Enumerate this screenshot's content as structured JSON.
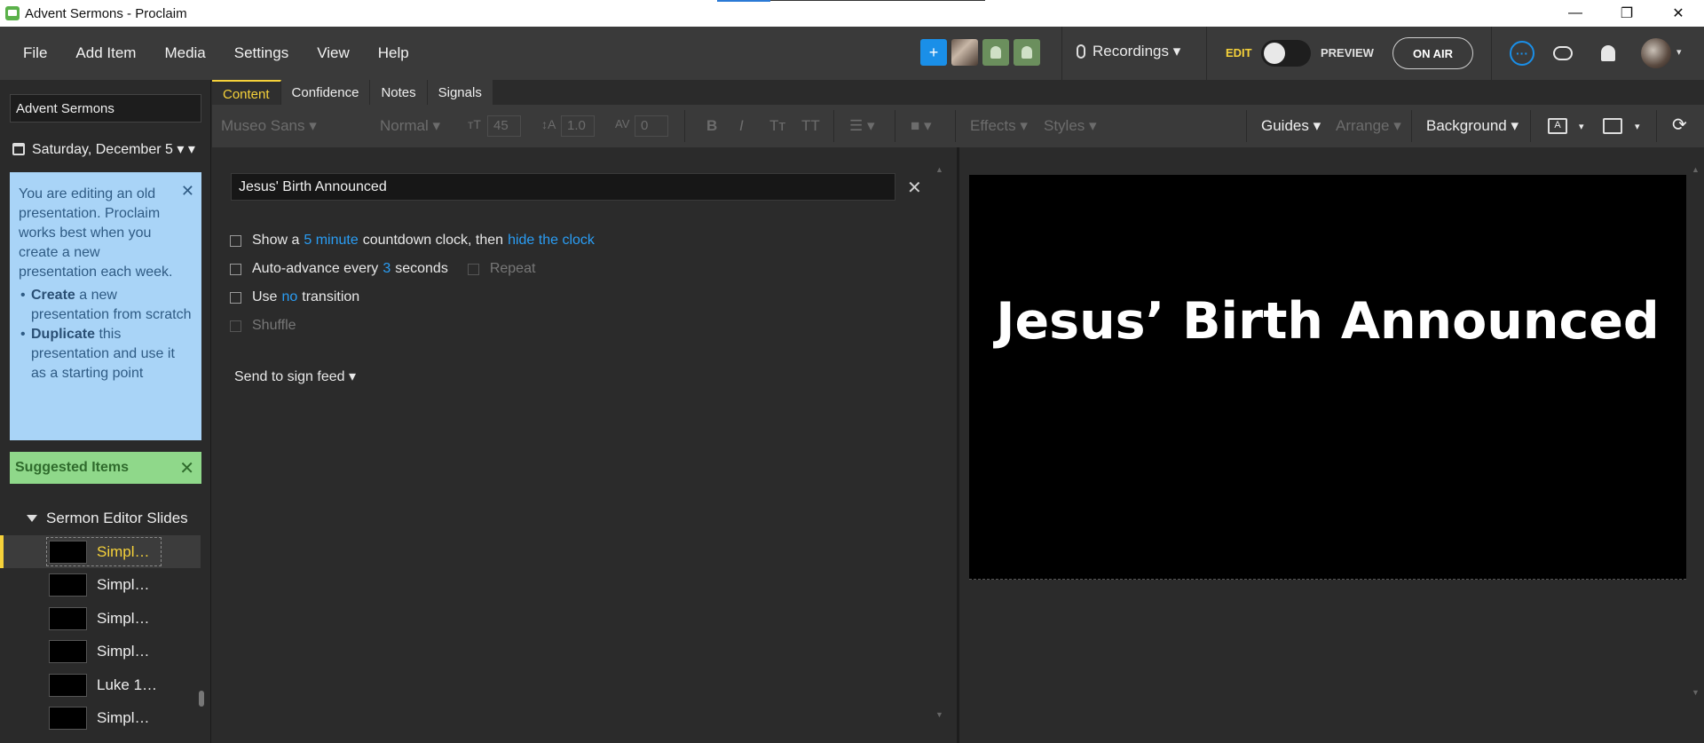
{
  "window": {
    "title": "Advent Sermons - Proclaim",
    "min": "—",
    "max": "❐",
    "close": "✕"
  },
  "menu": {
    "items": [
      "File",
      "Add Item",
      "Media",
      "Settings",
      "View",
      "Help"
    ]
  },
  "topbar": {
    "recordings": "Recordings ▾",
    "edit": "EDIT",
    "preview": "PREVIEW",
    "on_air": "ON AIR",
    "more_icon": "···",
    "add_user": "+",
    "user_caret": "▾"
  },
  "sidebar": {
    "presentation": "Advent Sermons",
    "date": "Saturday, December 5 ▾ ▾",
    "note": {
      "text": "You are editing an old presentation. Proclaim works best when you create a new presentation each week.",
      "bullet1_bold": "Create",
      "bullet1_rest": " a new presentation from scratch",
      "bullet2_bold": "Duplicate",
      "bullet2_rest": " this presentation and use it as a starting point",
      "close": "✕"
    },
    "suggested": "Suggested Items",
    "suggested_close": "✕",
    "group": "Sermon Editor Slides",
    "slides": [
      "Simpl…",
      "Simpl…",
      "Simpl…",
      "Simpl…",
      "Luke 1…",
      "Simpl…"
    ]
  },
  "tabs": [
    "Content",
    "Confidence",
    "Notes",
    "Signals"
  ],
  "toolbar": {
    "font": "Museo Sans ▾",
    "weight": "Normal ▾",
    "size": "45",
    "line_height": "1.0",
    "spacing": "0",
    "bold": "B",
    "italic": "I",
    "tt1": "Tт",
    "tt2": "TT",
    "align": "☰ ▾",
    "color": "■ ▾",
    "effects": "Effects ▾",
    "styles": "Styles ▾",
    "guides": "Guides ▾",
    "arrange": "Arrange ▾",
    "background": "Background ▾",
    "refresh": "⟳"
  },
  "editor": {
    "title_value": "Jesus' Birth Announced",
    "clear": "✕",
    "countdown": {
      "pre": "Show a",
      "minutes": "5 minute",
      "mid": "countdown clock, then",
      "action": "hide the clock"
    },
    "autoadvance": {
      "pre": "Auto-advance every",
      "seconds": "3",
      "post": "seconds",
      "repeat": "Repeat"
    },
    "transition": {
      "pre": "Use",
      "value": "no",
      "post": "transition"
    },
    "shuffle": "Shuffle",
    "send_feed": "Send to sign feed ▾"
  },
  "preview": {
    "slide_title": "Jesus’ Birth Announced"
  },
  "colors": {
    "accent": "#f6d23a",
    "link": "#2a9df4",
    "note_bg": "#a9d4f7",
    "suggested_bg": "#8fd88a"
  }
}
